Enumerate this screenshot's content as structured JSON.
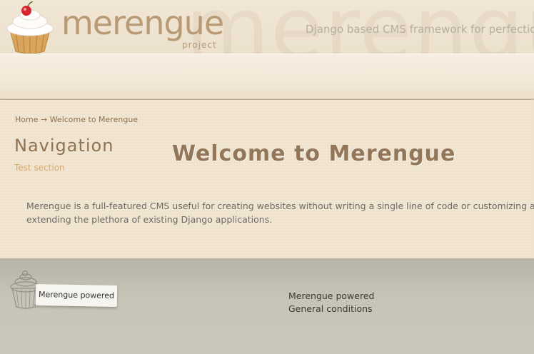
{
  "header": {
    "logo_text": "merengue",
    "logo_sub": "project",
    "tagline": "Django based CMS framework for perfection",
    "watermark": "merengue"
  },
  "breadcrumb": {
    "home": "Home",
    "separator": "→",
    "current": "Welcome to Merengue"
  },
  "sidebar": {
    "title": "Navigation",
    "items": [
      {
        "label": "Test section"
      }
    ]
  },
  "main": {
    "title": "Welcome to Merengue",
    "intro": "Merengue is a full-featured CMS useful for creating websites without writing a single line of code or customizing and extending the plethora of existing Django applications."
  },
  "footer": {
    "badge": "Merengue powered",
    "links": [
      {
        "label": "Merengue powered"
      },
      {
        "label": "General conditions"
      }
    ]
  },
  "colors": {
    "header_bg": "#efe4d2",
    "content_bg": "#efe3cd",
    "footer_bg": "#c6c3b6",
    "title_color": "#92765a",
    "link_color": "#d6a96e"
  }
}
